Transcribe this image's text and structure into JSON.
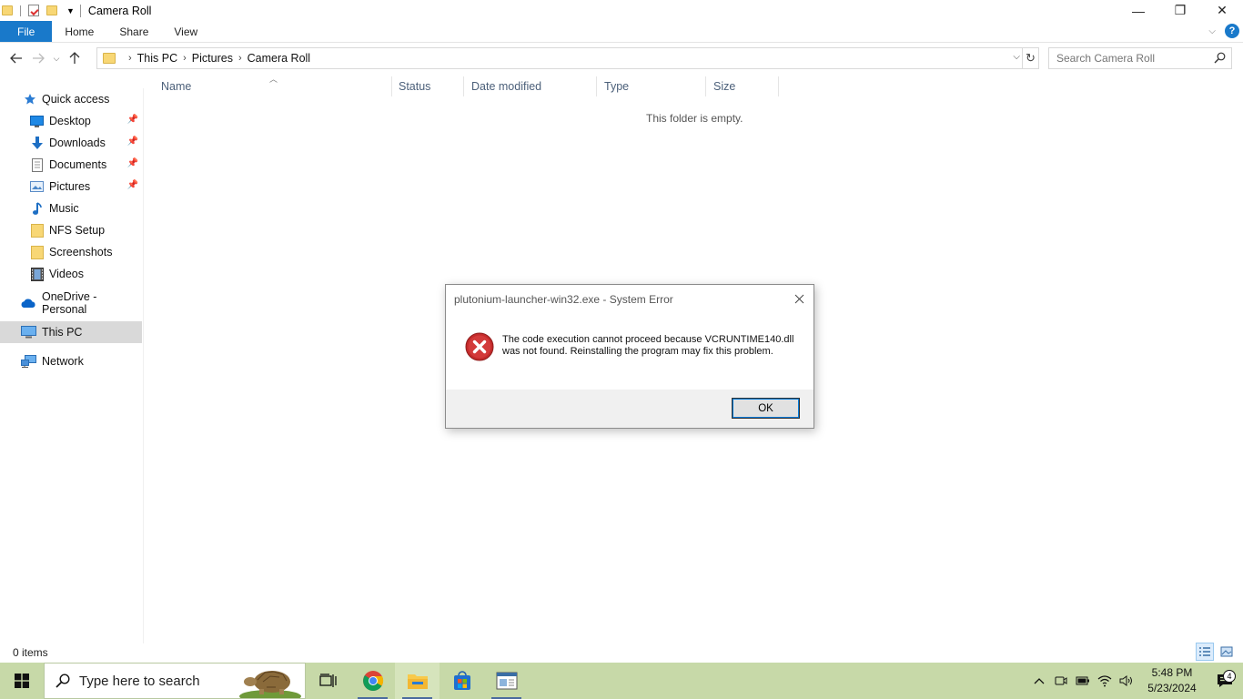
{
  "window": {
    "title": "Camera Roll",
    "controls": {
      "minimize": "—",
      "restore": "❐",
      "close": "✕"
    }
  },
  "ribbon": {
    "tabs": [
      "File",
      "Home",
      "Share",
      "View"
    ],
    "help": "?"
  },
  "address": {
    "crumbs": [
      "This PC",
      "Pictures",
      "Camera Roll"
    ]
  },
  "search": {
    "placeholder": "Search Camera Roll"
  },
  "sidebar": {
    "quick_access": "Quick access",
    "pinned": [
      "Desktop",
      "Downloads",
      "Documents",
      "Pictures"
    ],
    "folders": [
      "Music",
      "NFS Setup",
      "Screenshots",
      "Videos"
    ],
    "onedrive": "OneDrive - Personal",
    "this_pc": "This PC",
    "network": "Network"
  },
  "columns": [
    "Name",
    "Status",
    "Date modified",
    "Type",
    "Size"
  ],
  "content": {
    "empty_message": "This folder is empty."
  },
  "status": {
    "items": "0 items"
  },
  "dialog": {
    "title": "plutonium-launcher-win32.exe - System Error",
    "message": "The code execution cannot proceed because VCRUNTIME140.dll was not found. Reinstalling the program may fix this problem.",
    "ok_label": "OK"
  },
  "taskbar": {
    "search_placeholder": "Type here to search",
    "time": "5:48 PM",
    "date": "5/23/2024",
    "notification_count": "4",
    "colors": {
      "background": "#c7d9a8",
      "accent": "#1979ca"
    }
  }
}
